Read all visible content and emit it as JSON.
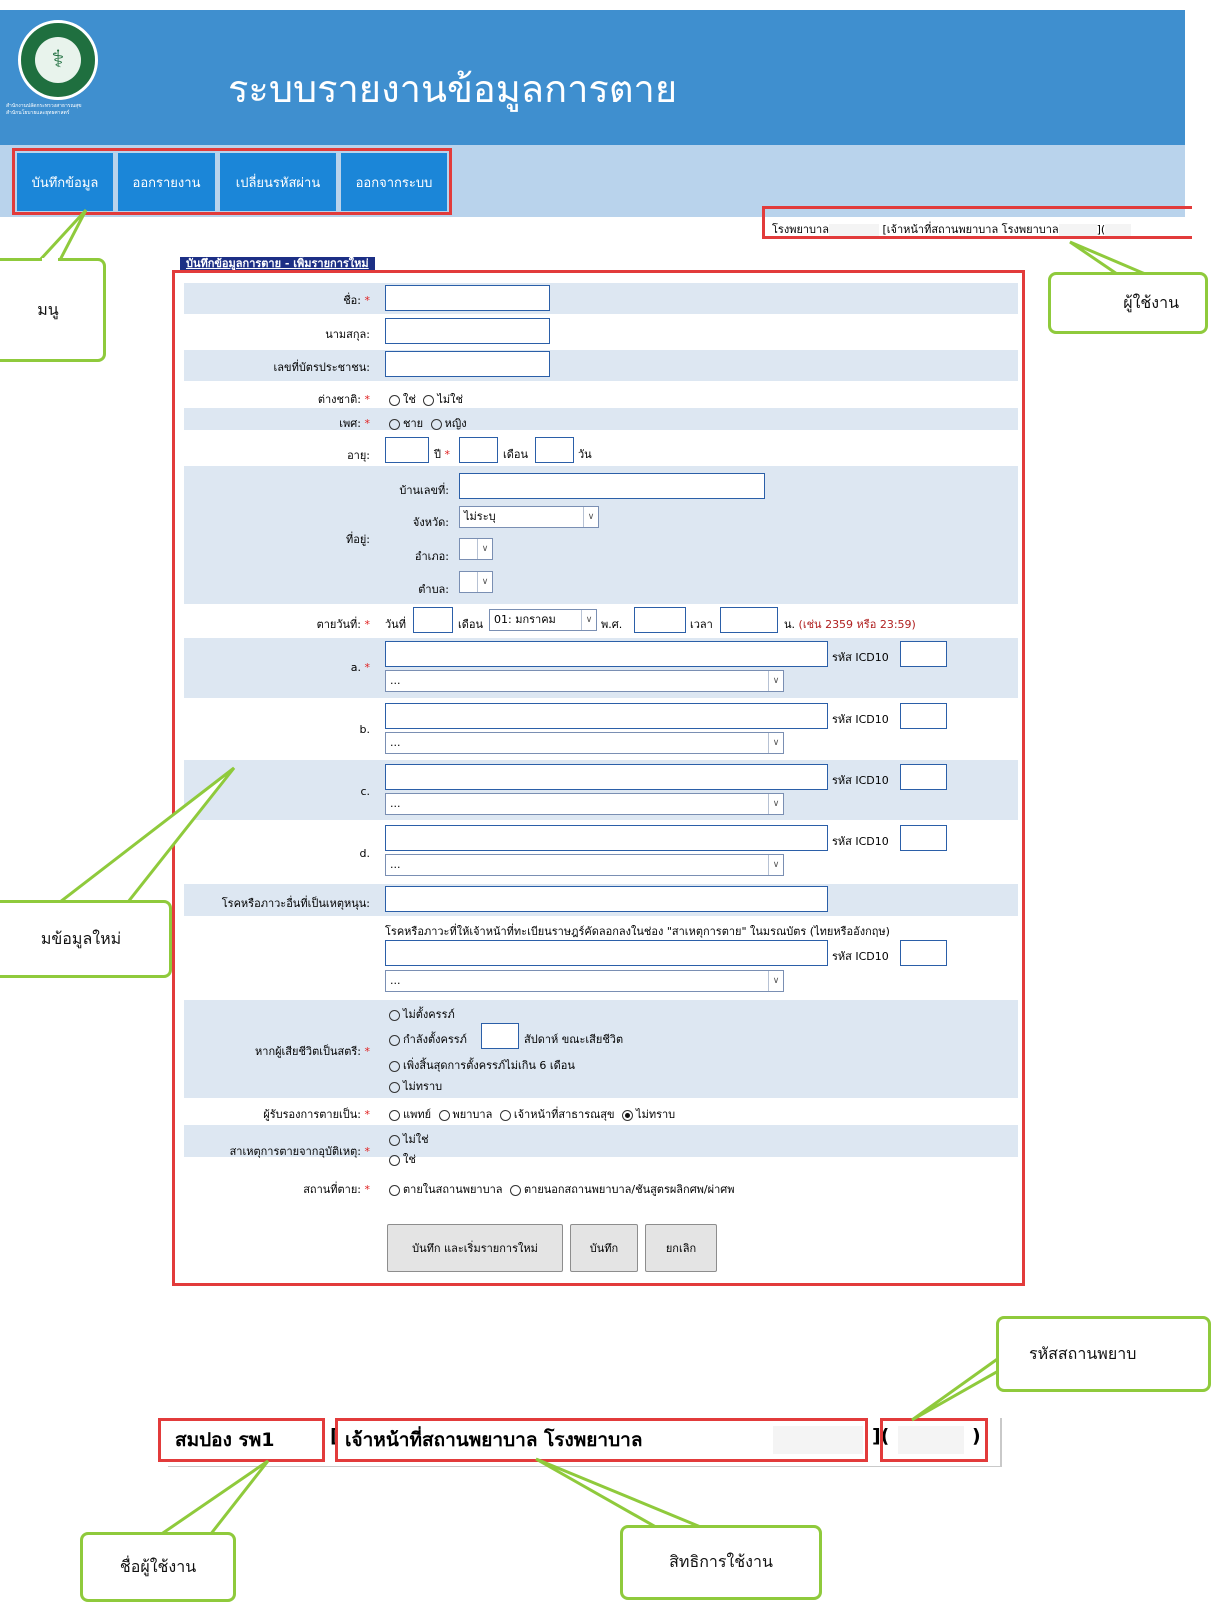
{
  "header": {
    "title": "ระบบรายงานข้อมูลการตาย",
    "logo_text": "MINISTRY OF PUBLIC HEALTH",
    "logo_caption_1": "สำนักงานปลัดกระทรวงสาธารณสุข",
    "logo_caption_2": "สำนักนโยบายและยุทธศาสตร์"
  },
  "nav": {
    "items": [
      "บันทึกข้อมูล",
      "ออกรายงาน",
      "เปลี่ยนรหัสผ่าน",
      "ออกจากระบบ"
    ]
  },
  "user_info": {
    "hospital": "โรงพยาบาล",
    "role": "[เจ้าหน้าที่สถานพยาบาล โรงพยาบาล",
    "code_open": "](",
    "code_close": ")"
  },
  "form": {
    "tab_title": "บันทึกข้อมูลการตาย - เพิ่มรายการใหม่",
    "labels": {
      "first_name": "ชื่อ:",
      "last_name": "นามสกุล:",
      "citizen_id": "เลขที่บัตรประชาชน:",
      "foreigner": "ต่างชาติ:",
      "sex": "เพศ:",
      "age": "อายุ:",
      "address": "ที่อยู่:",
      "death_date": "ตายวันที่:",
      "cause_a": "a.",
      "cause_b": "b.",
      "cause_c": "c.",
      "cause_d": "d.",
      "other_contrib": "โรคหรือภาวะอื่นที่เป็นเหตุหนุน:",
      "pregnant": "หากผู้เสียชีวิตเป็นสตรี:",
      "certifier": "ผู้รับรองการตายเป็น:",
      "accident": "สาเหตุการตายจากอุบัติเหตุ:",
      "place": "สถานที่ตาย:"
    },
    "required_mark": "*",
    "foreigner_options": [
      "ใช่",
      "ไม่ใช่"
    ],
    "sex_options": [
      "ชาย",
      "หญิง"
    ],
    "age_units": {
      "year": "ปี",
      "month": "เดือน",
      "day": "วัน"
    },
    "address": {
      "house_no": "บ้านเลขที่:",
      "province": "จังหวัด:",
      "province_value": "ไม่ระบุ",
      "district": "อำเภอ:",
      "subdistrict": "ตำบล:"
    },
    "date": {
      "day": "วันที่",
      "month": "เดือน",
      "month_value": "01: มกราคม",
      "year": "พ.ศ.",
      "time": "เวลา",
      "time_unit": "น.",
      "time_hint": "(เช่น 2359 หรือ 23:59)"
    },
    "icd10_label": "รหัส ICD10",
    "dropdown_placeholder": "...",
    "registrar_note": "โรคหรือภาวะที่ให้เจ้าหน้าที่ทะเบียนราษฎร์คัดลอกลงในช่อง \"สาเหตุการตาย\" ในมรณบัตร (ไทยหรืออังกฤษ)",
    "pregnant_options": [
      "ไม่ตั้งครรภ์",
      "กำลังตั้งครรภ์",
      "เพิ่งสิ้นสุดการตั้งครรภ์ไม่เกิน 6 เดือน",
      "ไม่ทราบ"
    ],
    "pregnant_week_suffix": "สัปดาห์ ขณะเสียชีวิต",
    "certifier_options": [
      "แพทย์",
      "พยาบาล",
      "เจ้าหน้าที่สาธารณสุข",
      "ไม่ทราบ"
    ],
    "certifier_selected": "ไม่ทราบ",
    "accident_options": [
      "ไม่ใช่",
      "ใช่"
    ],
    "place_options": [
      "ตายในสถานพยาบาล",
      "ตายนอกสถานพยาบาล/ชันสูตรผลิกศพ/ผ่าศพ"
    ],
    "buttons": {
      "save_new": "บันทึก และเริ่มรายการใหม่",
      "save": "บันทึก",
      "cancel": "ยกเลิก"
    }
  },
  "callouts": {
    "menu": "มนู",
    "user": "ผู้ใช้งาน",
    "new_data": "มข้อมูลใหม่",
    "hospital_code": "รหัสสถานพยาบ",
    "username": "ชื่อผู้ใช้งาน",
    "permission": "สิทธิการใช้งาน"
  },
  "zoom": {
    "username": "สมปอง รพ1",
    "bracket_open": "[",
    "role": "เจ้าหน้าที่สถานพยาบาล โรงพยาบาล",
    "code_open": "](",
    "code_close": ")"
  },
  "colors": {
    "header_bg": "#3f8fcf",
    "nav_bg": "#b9d3ec",
    "nav_button": "#1b86d8",
    "highlight_red": "#e23b3b",
    "callout_green": "#8fca3c",
    "row_bg": "#dde7f2",
    "required": "#e02020"
  }
}
